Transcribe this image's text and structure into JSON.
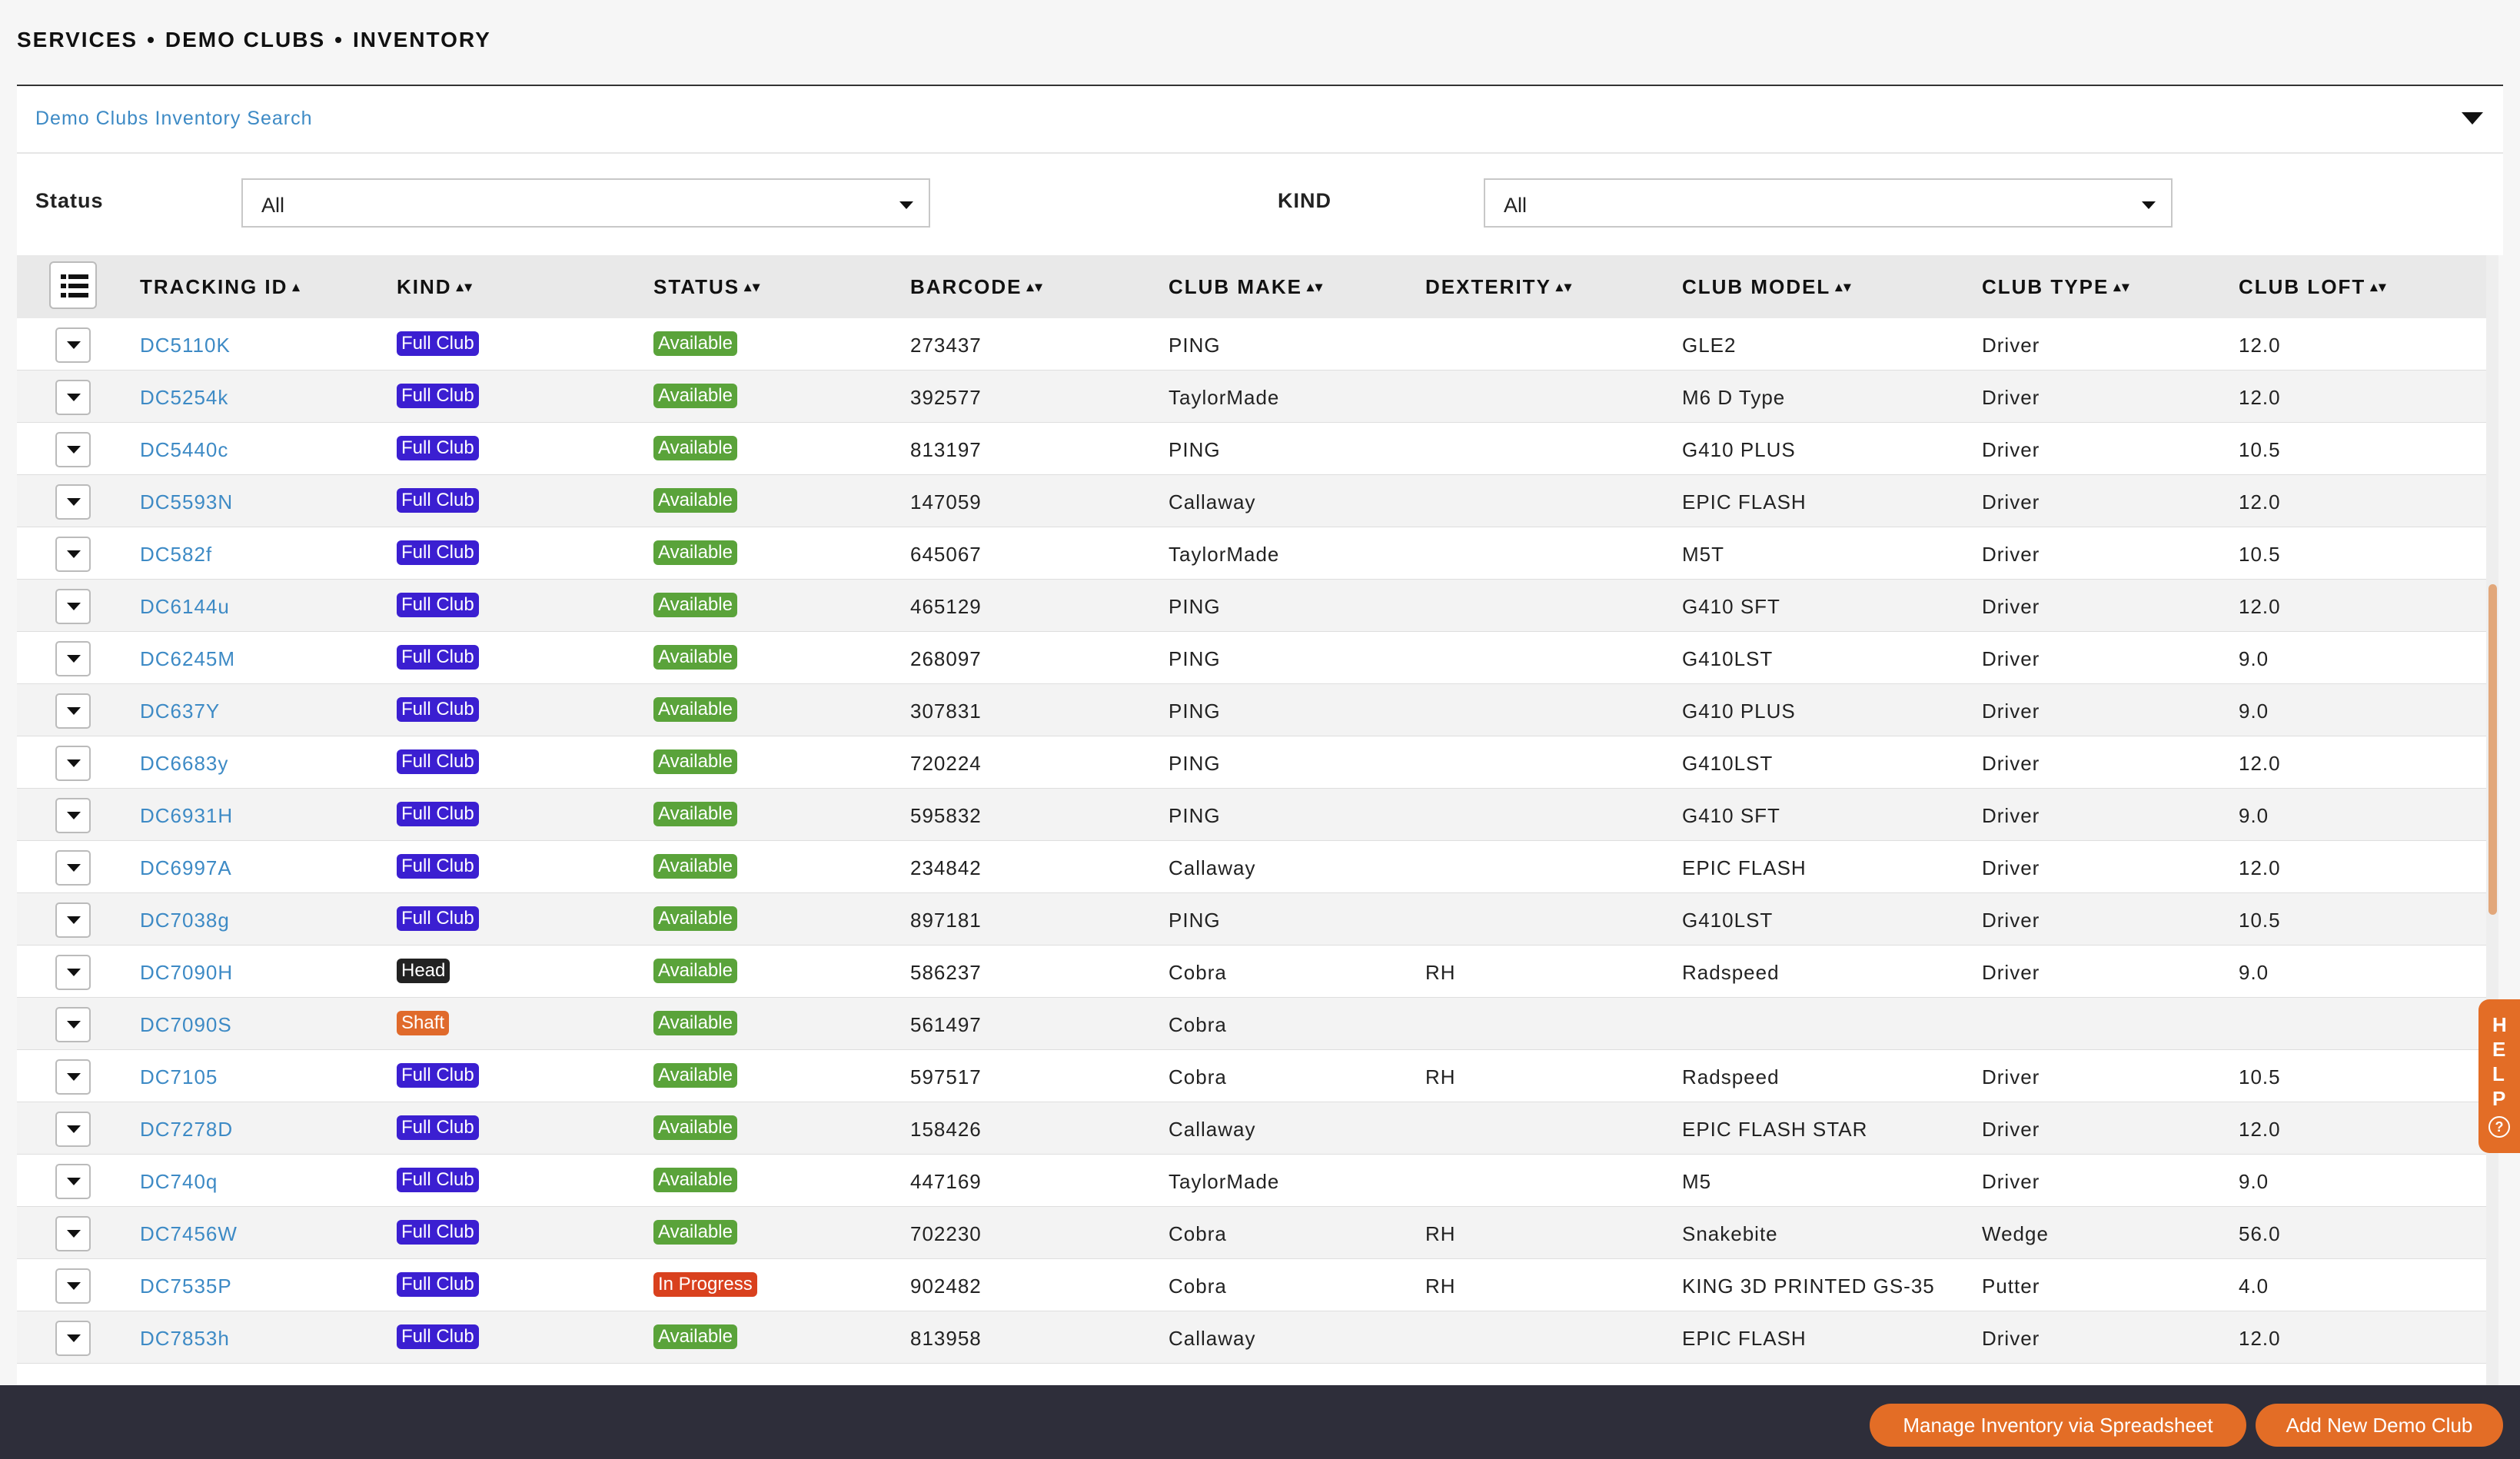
{
  "breadcrumb": [
    "SERVICES",
    "DEMO CLUBS",
    "INVENTORY"
  ],
  "search": {
    "title": "Demo Clubs Inventory Search",
    "status_label": "Status",
    "status_value": "All",
    "kind_label": "KIND",
    "kind_value": "All"
  },
  "table": {
    "columns": [
      "TRACKING ID",
      "KIND",
      "STATUS",
      "BARCODE",
      "CLUB MAKE",
      "DEXTERITY",
      "CLUB MODEL",
      "CLUB TYPE",
      "CLUB LOFT"
    ],
    "sort_icons": [
      "▴",
      "▴▾",
      "▴▾",
      "▴▾",
      "▴▾",
      "▴▾",
      "▴▾",
      "▴▾",
      "▴▾"
    ],
    "rows": [
      {
        "tracking": "DC5110K",
        "kind": "Full Club",
        "status": "Available",
        "barcode": "273437",
        "make": "PING",
        "dexterity": "",
        "model": "GLE2",
        "type": "Driver",
        "loft": "12.0"
      },
      {
        "tracking": "DC5254k",
        "kind": "Full Club",
        "status": "Available",
        "barcode": "392577",
        "make": "TaylorMade",
        "dexterity": "",
        "model": "M6 D Type",
        "type": "Driver",
        "loft": "12.0"
      },
      {
        "tracking": "DC5440c",
        "kind": "Full Club",
        "status": "Available",
        "barcode": "813197",
        "make": "PING",
        "dexterity": "",
        "model": "G410 PLUS",
        "type": "Driver",
        "loft": "10.5"
      },
      {
        "tracking": "DC5593N",
        "kind": "Full Club",
        "status": "Available",
        "barcode": "147059",
        "make": "Callaway",
        "dexterity": "",
        "model": "EPIC FLASH",
        "type": "Driver",
        "loft": "12.0"
      },
      {
        "tracking": "DC582f",
        "kind": "Full Club",
        "status": "Available",
        "barcode": "645067",
        "make": "TaylorMade",
        "dexterity": "",
        "model": "M5T",
        "type": "Driver",
        "loft": "10.5"
      },
      {
        "tracking": "DC6144u",
        "kind": "Full Club",
        "status": "Available",
        "barcode": "465129",
        "make": "PING",
        "dexterity": "",
        "model": "G410 SFT",
        "type": "Driver",
        "loft": "12.0"
      },
      {
        "tracking": "DC6245M",
        "kind": "Full Club",
        "status": "Available",
        "barcode": "268097",
        "make": "PING",
        "dexterity": "",
        "model": "G410LST",
        "type": "Driver",
        "loft": "9.0"
      },
      {
        "tracking": "DC637Y",
        "kind": "Full Club",
        "status": "Available",
        "barcode": "307831",
        "make": "PING",
        "dexterity": "",
        "model": "G410 PLUS",
        "type": "Driver",
        "loft": "9.0"
      },
      {
        "tracking": "DC6683y",
        "kind": "Full Club",
        "status": "Available",
        "barcode": "720224",
        "make": "PING",
        "dexterity": "",
        "model": "G410LST",
        "type": "Driver",
        "loft": "12.0"
      },
      {
        "tracking": "DC6931H",
        "kind": "Full Club",
        "status": "Available",
        "barcode": "595832",
        "make": "PING",
        "dexterity": "",
        "model": "G410 SFT",
        "type": "Driver",
        "loft": "9.0"
      },
      {
        "tracking": "DC6997A",
        "kind": "Full Club",
        "status": "Available",
        "barcode": "234842",
        "make": "Callaway",
        "dexterity": "",
        "model": "EPIC FLASH",
        "type": "Driver",
        "loft": "12.0"
      },
      {
        "tracking": "DC7038g",
        "kind": "Full Club",
        "status": "Available",
        "barcode": "897181",
        "make": "PING",
        "dexterity": "",
        "model": "G410LST",
        "type": "Driver",
        "loft": "10.5"
      },
      {
        "tracking": "DC7090H",
        "kind": "Head",
        "status": "Available",
        "barcode": "586237",
        "make": "Cobra",
        "dexterity": "RH",
        "model": "Radspeed",
        "type": "Driver",
        "loft": "9.0"
      },
      {
        "tracking": "DC7090S",
        "kind": "Shaft",
        "status": "Available",
        "barcode": "561497",
        "make": "Cobra",
        "dexterity": "",
        "model": "",
        "type": "",
        "loft": ""
      },
      {
        "tracking": "DC7105",
        "kind": "Full Club",
        "status": "Available",
        "barcode": "597517",
        "make": "Cobra",
        "dexterity": "RH",
        "model": "Radspeed",
        "type": "Driver",
        "loft": "10.5"
      },
      {
        "tracking": "DC7278D",
        "kind": "Full Club",
        "status": "Available",
        "barcode": "158426",
        "make": "Callaway",
        "dexterity": "",
        "model": "EPIC FLASH STAR",
        "type": "Driver",
        "loft": "12.0"
      },
      {
        "tracking": "DC740q",
        "kind": "Full Club",
        "status": "Available",
        "barcode": "447169",
        "make": "TaylorMade",
        "dexterity": "",
        "model": "M5",
        "type": "Driver",
        "loft": "9.0"
      },
      {
        "tracking": "DC7456W",
        "kind": "Full Club",
        "status": "Available",
        "barcode": "702230",
        "make": "Cobra",
        "dexterity": "RH",
        "model": "Snakebite",
        "type": "Wedge",
        "loft": "56.0"
      },
      {
        "tracking": "DC7535P",
        "kind": "Full Club",
        "status": "In Progress",
        "barcode": "902482",
        "make": "Cobra",
        "dexterity": "RH",
        "model": "KING 3D PRINTED GS-35",
        "type": "Putter",
        "loft": "4.0"
      },
      {
        "tracking": "DC7853h",
        "kind": "Full Club",
        "status": "Available",
        "barcode": "813958",
        "make": "Callaway",
        "dexterity": "",
        "model": "EPIC FLASH",
        "type": "Driver",
        "loft": "12.0"
      }
    ]
  },
  "help": {
    "letters": [
      "H",
      "E",
      "L",
      "P"
    ],
    "icon": "?"
  },
  "footer": {
    "manage_label": "Manage Inventory via Spreadsheet",
    "add_label": "Add New Demo Club"
  },
  "colors": {
    "accent_orange": "#e36d26",
    "link_blue": "#3d8ac5",
    "full_club_badge": "#3b1fd1",
    "available_badge": "#5aa33a",
    "in_progress_badge": "#d9411e",
    "shaft_badge": "#e06a2b",
    "footer_bg": "#2e2e3a"
  }
}
